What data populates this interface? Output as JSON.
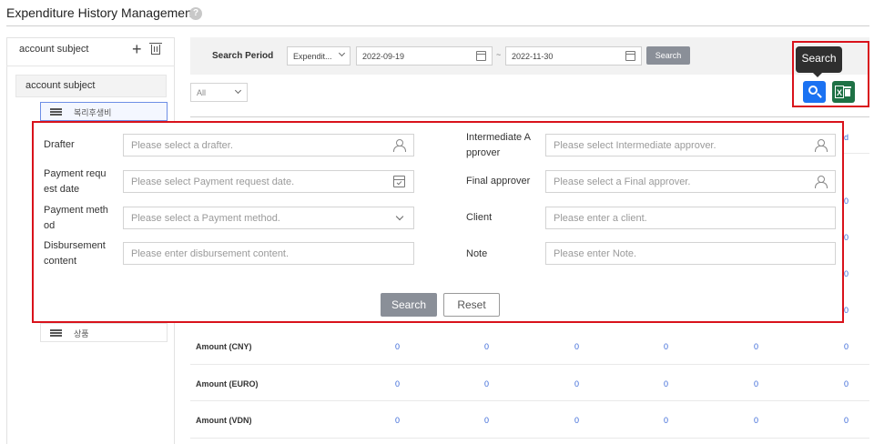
{
  "header": {
    "title": "Expenditure History Management",
    "help_icon": "help-icon"
  },
  "left_panel": {
    "title": "account subject",
    "add_icon": "plus-icon",
    "delete_icon": "trash-icon",
    "tree_root": "account subject",
    "items": [
      {
        "label": "복리후생비",
        "selected": true
      },
      {
        "label": "상품",
        "selected": false
      }
    ]
  },
  "search_bar": {
    "period_label": "Search Period",
    "period_type": "Expendit...",
    "date_from": "2022-09-19",
    "date_separator": "~",
    "date_to": "2022-11-30",
    "search_button": "Search",
    "filter_value": "All"
  },
  "toolbar": {
    "tooltip": "Search",
    "search_icon": "magnifier-icon",
    "excel_icon": "excel-icon"
  },
  "table": {
    "header_peek": "d",
    "peek_values": [
      "0",
      "0",
      "0",
      "0"
    ],
    "rows": [
      {
        "label": "Amount (CNY)",
        "values": [
          "0",
          "0",
          "0",
          "0",
          "0",
          "0"
        ]
      },
      {
        "label": "Amount (EURO)",
        "values": [
          "0",
          "0",
          "0",
          "0",
          "0",
          "0"
        ]
      },
      {
        "label": "Amount (VDN)",
        "values": [
          "0",
          "0",
          "0",
          "0",
          "0",
          "0"
        ]
      }
    ]
  },
  "modal": {
    "fields": {
      "drafter": {
        "label": "Drafter",
        "placeholder": "Please select a drafter."
      },
      "payment_request_date": {
        "label_1": "Payment requ",
        "label_2": "est date",
        "placeholder": "Please select Payment request date."
      },
      "payment_method": {
        "label_1": "Payment meth",
        "label_2": "od",
        "placeholder": "Please select a Payment method."
      },
      "disbursement_content": {
        "label_1": "Disbursement",
        "label_2": "content",
        "placeholder": "Please enter disbursement content."
      },
      "intermediate_approver": {
        "label_1": "Intermediate A",
        "label_2": "pprover",
        "placeholder": "Please select Intermediate approver."
      },
      "final_approver": {
        "label": "Final approver",
        "placeholder": "Please select a Final approver."
      },
      "client": {
        "label": "Client",
        "placeholder": "Please enter a client."
      },
      "note": {
        "label": "Note",
        "placeholder": "Please enter Note."
      }
    },
    "search_button": "Search",
    "reset_button": "Reset"
  },
  "colors": {
    "highlight_border": "#d9121b",
    "primary_blue": "#1b72f2",
    "excel_green": "#1e7145",
    "gray_button": "#8a8f98",
    "value_blue": "#3a68d8"
  }
}
